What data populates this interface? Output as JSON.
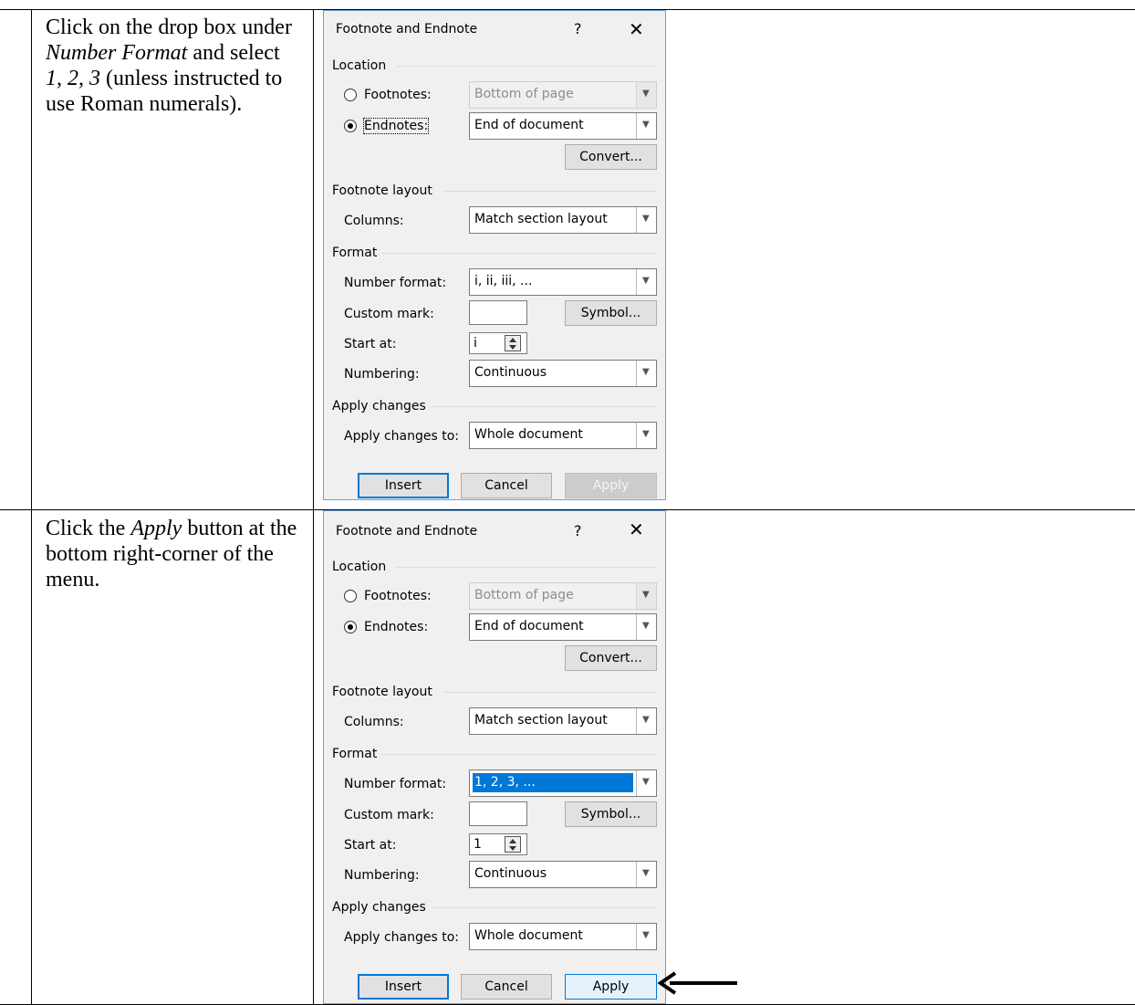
{
  "rows": [
    {
      "instruction": {
        "p1": "Click on the drop box under ",
        "em1": "Number Format",
        "p2": " and select ",
        "em2": "1, 2, 3",
        "p3": " (unless instructed to use Roman numerals)."
      },
      "dialog": {
        "title": "Footnote and Endnote",
        "help": "?",
        "close": "✕",
        "location": "Location",
        "footnotes_label": "Footnotes:",
        "footnotes_value": "Bottom of page",
        "endnotes_label": "Endnotes:",
        "endnotes_value": "End of document",
        "convert": "Convert...",
        "layout": "Footnote layout",
        "columns_label": "Columns:",
        "columns_value": "Match section layout",
        "format": "Format",
        "number_format_label": "Number format:",
        "number_format_value": "i, ii, iii, ...",
        "custom_mark_label": "Custom mark:",
        "symbol": "Symbol...",
        "start_at_label": "Start at:",
        "start_at_value": "i",
        "numbering_label": "Numbering:",
        "numbering_value": "Continuous",
        "apply_changes": "Apply changes",
        "apply_to_label": "Apply changes to:",
        "apply_to_value": "Whole document",
        "insert": "Insert",
        "cancel": "Cancel",
        "apply": "Apply"
      }
    },
    {
      "instruction": {
        "p1": "Click the ",
        "em1": "Apply",
        "p2": " button at the bottom right-corner of the menu."
      },
      "dialog": {
        "title": "Footnote and Endnote",
        "help": "?",
        "close": "✕",
        "location": "Location",
        "footnotes_label": "Footnotes:",
        "footnotes_value": "Bottom of page",
        "endnotes_label": "Endnotes:",
        "endnotes_value": "End of document",
        "convert": "Convert...",
        "layout": "Footnote layout",
        "columns_label": "Columns:",
        "columns_value": "Match section layout",
        "format": "Format",
        "number_format_label": "Number format:",
        "number_format_value": "1, 2, 3, ...",
        "custom_mark_label": "Custom mark:",
        "symbol": "Symbol...",
        "start_at_label": "Start at:",
        "start_at_value": "1",
        "numbering_label": "Numbering:",
        "numbering_value": "Continuous",
        "apply_changes": "Apply changes",
        "apply_to_label": "Apply changes to:",
        "apply_to_value": "Whole document",
        "insert": "Insert",
        "cancel": "Cancel",
        "apply": "Apply"
      }
    }
  ]
}
